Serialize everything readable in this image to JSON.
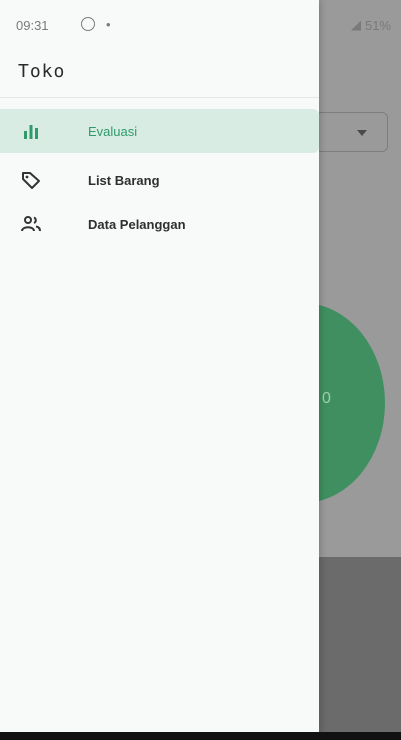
{
  "status_bar": {
    "time": "09:31",
    "dot": "•",
    "battery": "51%"
  },
  "drawer": {
    "title": "Toko",
    "items": [
      {
        "label": "Evaluasi",
        "icon": "bar-chart-icon",
        "active": true
      },
      {
        "label": "List Barang",
        "icon": "tag-icon",
        "active": false
      },
      {
        "label": "Data Pelanggan",
        "icon": "people-icon",
        "active": false
      }
    ]
  },
  "background": {
    "chart_value_label": "0"
  },
  "colors": {
    "accent": "#2f9b6b",
    "active_bg": "#d8ece3",
    "chart_green": "#3f8f61"
  }
}
